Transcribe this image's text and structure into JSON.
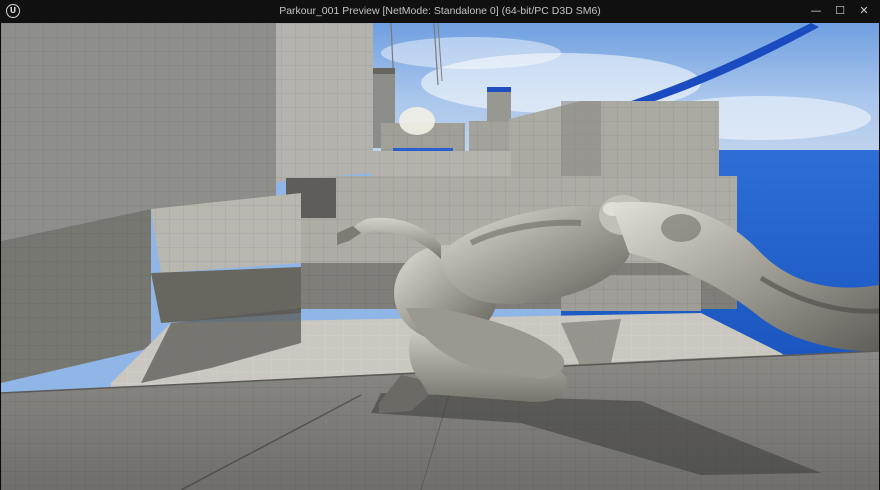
{
  "window": {
    "title": "Parkour_001 Preview [NetMode: Standalone 0]  (64-bit/PC D3D SM6)",
    "app_icon": "unreal-engine-logo-icon",
    "app_icon_glyph": "U",
    "controls": {
      "minimize": {
        "icon": "minimize-icon",
        "glyph": "—"
      },
      "maximize": {
        "icon": "maximize-icon",
        "glyph": "☐"
      },
      "close": {
        "icon": "close-icon",
        "glyph": "✕"
      }
    }
  },
  "viewport": {
    "scene": "game-viewport",
    "colors": {
      "sky": "#8fb6e6",
      "ocean": "#1f5ec8",
      "wall": "#8e8e8a",
      "floor": "#a7a6a0",
      "character": "#b9b7ad",
      "accent_blue": "#1a4bc0"
    }
  }
}
